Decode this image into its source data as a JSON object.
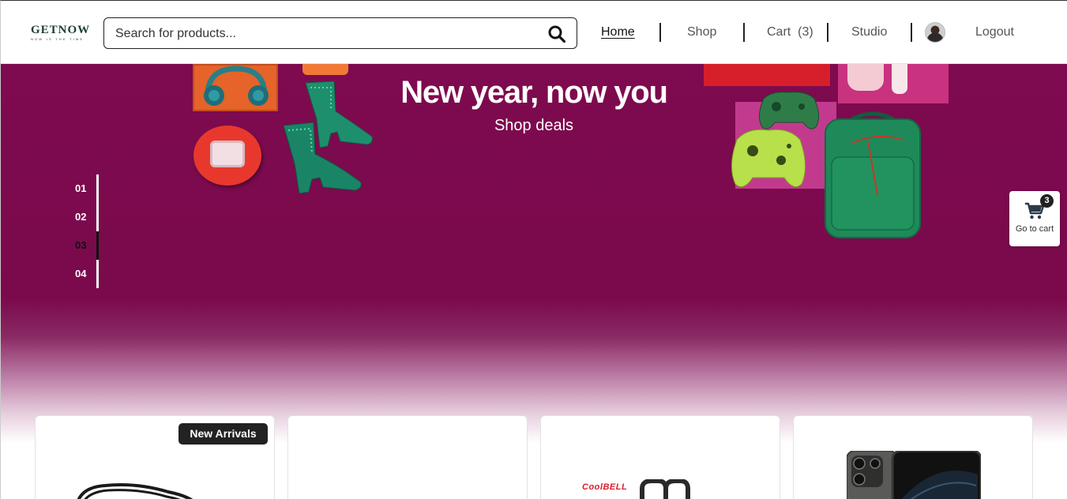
{
  "header": {
    "logo_text": "GETNOW",
    "logo_tagline": "NOW IS THE TIME",
    "search_placeholder": "Search for products...",
    "nav": {
      "home": "Home",
      "shop": "Shop",
      "cart": "Cart  (3)",
      "studio": "Studio",
      "logout": "Logout"
    }
  },
  "hero": {
    "title": "New year, now you",
    "subtitle": "Shop deals",
    "slides": [
      "01",
      "02",
      "03",
      "04"
    ],
    "active_slide": "03",
    "background_color": "#7e0a4f"
  },
  "floating_cart": {
    "count": "3",
    "label": "Go to cart"
  },
  "products": {
    "badge": "New Arrivals",
    "brand_logo": "CoolBELL"
  },
  "colors": {
    "accent_dark": "#222222",
    "hero_magenta": "#7e0a4f",
    "logo_green": "#1e4030"
  }
}
